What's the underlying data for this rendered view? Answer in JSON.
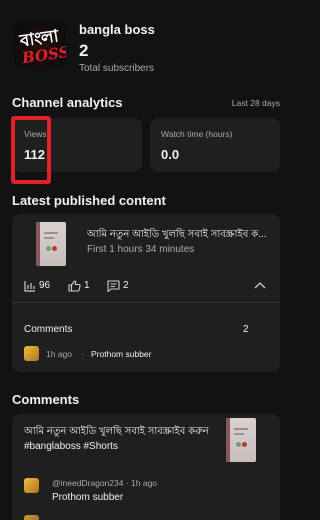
{
  "header": {
    "logo_text_top": "বাংলা",
    "logo_text_bottom": "BOSS",
    "channel_name": "bangla boss",
    "subscriber_count": "2",
    "subscriber_label": "Total subscribers"
  },
  "analytics": {
    "title": "Channel analytics",
    "range": "Last 28 days",
    "views_label": "Views",
    "views_value": "112",
    "watch_label": "Watch time (hours)",
    "watch_value": "0.0"
  },
  "latest": {
    "title": "Latest published content",
    "video_title": "আমি নতুন আইডি খুলছি সবাই সাবস্ক্রাইব ক...",
    "published": "First 1 hours 34 minutes",
    "views": "96",
    "likes": "1",
    "comments": "2",
    "comments_label": "Comments",
    "comments_count": "2",
    "comment_time": "1h ago",
    "comment_dot": "·",
    "comment_text": "Prothom subber"
  },
  "comments_section": {
    "title": "Comments",
    "video_title": "আমি নতুন আইডি খুলছি সবাই সাবস্ক্রাইব করুন #banglaboss #Shorts",
    "author_meta": "@ineedDragon234 · 1h ago",
    "comment_text": "Prothom subber"
  },
  "colors": {
    "background": "#121212",
    "card": "#1f1f1f",
    "highlight": "#e0202a"
  },
  "icons": [
    "bar-chart-icon",
    "thumbs-up-icon",
    "comment-icon",
    "chevron-up-icon"
  ]
}
